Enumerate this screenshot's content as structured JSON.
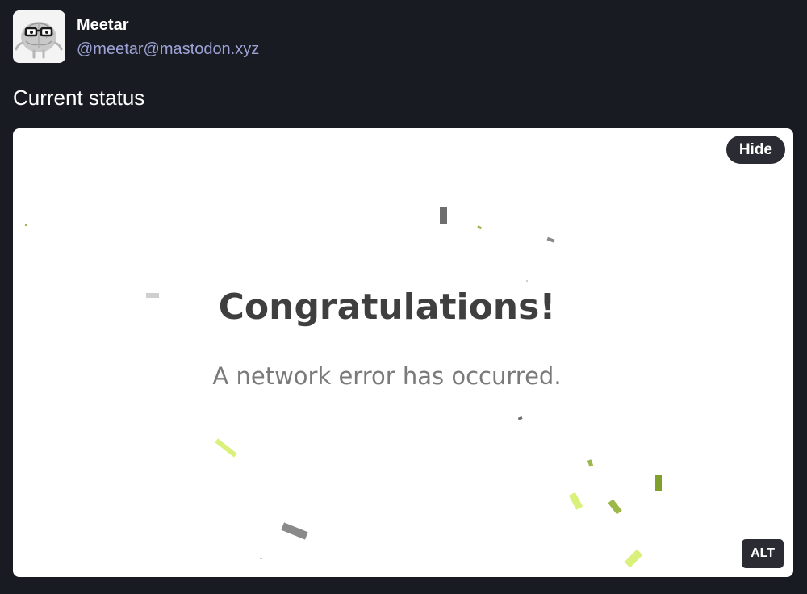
{
  "author": {
    "display_name": "Meetar",
    "handle": "@meetar@mastodon.xyz",
    "avatar_icon": "brain-with-glasses-icon"
  },
  "status": {
    "text": "Current status"
  },
  "media": {
    "heading": "Congratulations!",
    "message": "A network error has occurred.",
    "hide_label": "Hide",
    "alt_label": "ALT",
    "confetti_colors": [
      "#6e6e6e",
      "#cfcfcf",
      "#9cb84a",
      "#d9f07a",
      "#8a8a8a"
    ]
  }
}
